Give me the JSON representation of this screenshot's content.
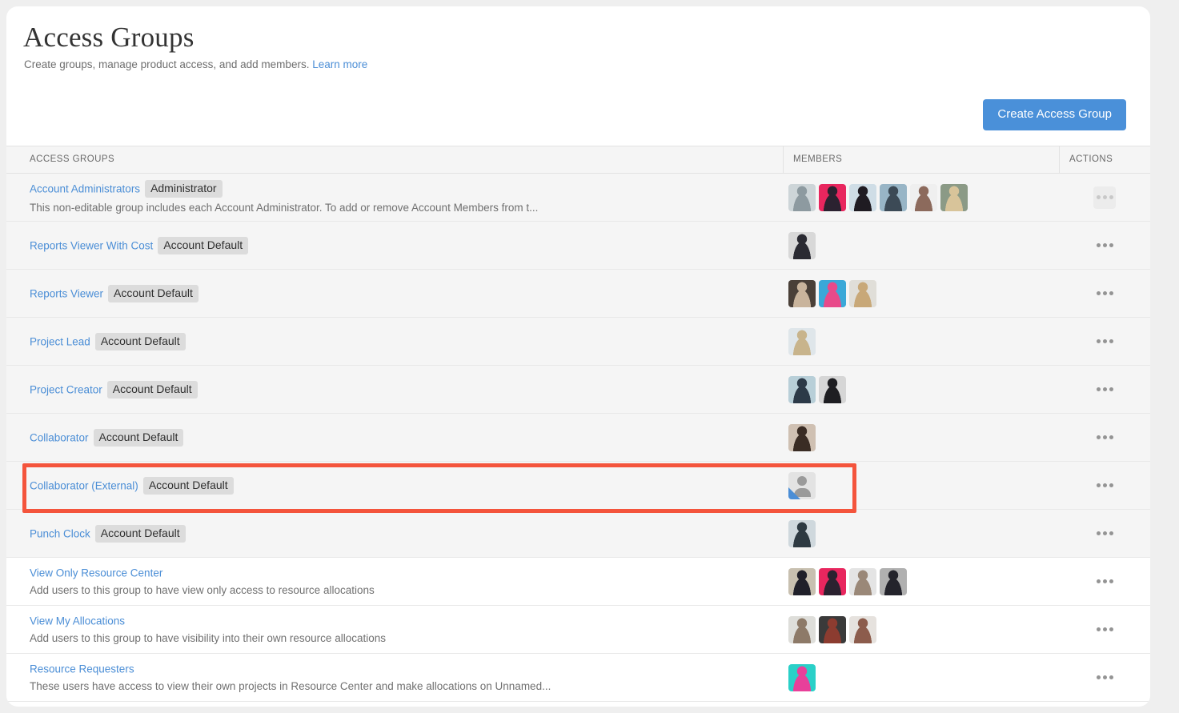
{
  "header": {
    "title": "Access Groups",
    "subtitle": "Create groups, manage product access, and add members.",
    "learn_more": "Learn more",
    "create_button": "Create Access Group"
  },
  "table": {
    "columns": [
      "ACCESS GROUPS",
      "MEMBERS",
      "ACTIONS"
    ],
    "rows": [
      {
        "name": "Account Administrators",
        "badge": "Administrator",
        "description": "This non-editable group includes each Account Administrator. To add or remove Account Members from t...",
        "shaded": true,
        "actions_muted": true,
        "members": [
          {
            "type": "photo",
            "colors": [
              "#cdd5d8",
              "#8d9aa0"
            ]
          },
          {
            "type": "photo",
            "colors": [
              "#e8265e",
              "#2b2230"
            ]
          },
          {
            "type": "photo",
            "colors": [
              "#cfdde6",
              "#1f1b22"
            ]
          },
          {
            "type": "photo",
            "colors": [
              "#98b5c6",
              "#3c4a56"
            ]
          },
          {
            "type": "photo",
            "colors": [
              "#efefef",
              "#8c6a5c"
            ]
          },
          {
            "type": "photo",
            "colors": [
              "#8b9a86",
              "#d8c49a"
            ]
          }
        ]
      },
      {
        "name": "Reports Viewer With Cost",
        "badge": "Account Default",
        "description": "",
        "shaded": true,
        "actions_muted": false,
        "members": [
          {
            "type": "photo",
            "colors": [
              "#d8d8d8",
              "#2a2a32"
            ]
          }
        ]
      },
      {
        "name": "Reports Viewer",
        "badge": "Account Default",
        "description": "",
        "shaded": true,
        "actions_muted": false,
        "members": [
          {
            "type": "photo",
            "colors": [
              "#4a4038",
              "#c9b49c"
            ]
          },
          {
            "type": "photo",
            "colors": [
              "#3aa8d8",
              "#e84a8a"
            ]
          },
          {
            "type": "photo",
            "colors": [
              "#e0ded8",
              "#c8a878"
            ]
          }
        ]
      },
      {
        "name": "Project Lead",
        "badge": "Account Default",
        "description": "",
        "shaded": true,
        "actions_muted": false,
        "members": [
          {
            "type": "photo",
            "colors": [
              "#dfe6ea",
              "#c8b48c"
            ]
          }
        ]
      },
      {
        "name": "Project Creator",
        "badge": "Account Default",
        "description": "",
        "shaded": true,
        "actions_muted": false,
        "members": [
          {
            "type": "photo",
            "colors": [
              "#b8cfd8",
              "#2c3a48"
            ]
          },
          {
            "type": "photo",
            "colors": [
              "#d6d6d6",
              "#1e1e22"
            ]
          }
        ]
      },
      {
        "name": "Collaborator",
        "badge": "Account Default",
        "description": "",
        "shaded": true,
        "actions_muted": false,
        "members": [
          {
            "type": "photo",
            "colors": [
              "#cfc0b2",
              "#3a2c24"
            ]
          }
        ]
      },
      {
        "name": "Collaborator (External)",
        "badge": "Account Default",
        "description": "",
        "shaded": true,
        "actions_muted": false,
        "highlighted": true,
        "members": [
          {
            "type": "placeholder"
          }
        ]
      },
      {
        "name": "Punch Clock",
        "badge": "Account Default",
        "description": "",
        "shaded": true,
        "actions_muted": false,
        "members": [
          {
            "type": "photo",
            "colors": [
              "#cfd8dd",
              "#2e3a42"
            ]
          }
        ]
      },
      {
        "name": "View Only Resource Center",
        "badge": "",
        "description": "Add users to this group to have view only access to resource allocations",
        "shaded": false,
        "actions_muted": false,
        "members": [
          {
            "type": "photo",
            "colors": [
              "#c8c0b0",
              "#20202a"
            ]
          },
          {
            "type": "photo",
            "colors": [
              "#e8265e",
              "#2b2230"
            ]
          },
          {
            "type": "photo",
            "colors": [
              "#e4e4e4",
              "#9a8878"
            ]
          },
          {
            "type": "photo",
            "colors": [
              "#b0b0b0",
              "#24242c"
            ]
          }
        ]
      },
      {
        "name": "View My Allocations",
        "badge": "",
        "description": "Add users to this group to have visibility into their own resource allocations",
        "shaded": false,
        "actions_muted": false,
        "members": [
          {
            "type": "photo",
            "colors": [
              "#dededa",
              "#8d7a68"
            ]
          },
          {
            "type": "photo",
            "colors": [
              "#3a3a3a",
              "#8c3c30"
            ]
          },
          {
            "type": "photo",
            "colors": [
              "#e6e2de",
              "#8c5c4c"
            ]
          }
        ]
      },
      {
        "name": "Resource Requesters",
        "badge": "",
        "description": "These users have access to view their own projects in Resource Center and make allocations on Unnamed...",
        "shaded": false,
        "actions_muted": false,
        "members": [
          {
            "type": "photo",
            "colors": [
              "#2ad0c8",
              "#e8409a"
            ]
          }
        ]
      }
    ]
  },
  "colors": {
    "accent": "#4a90d9",
    "link": "#4b8ed6",
    "highlight": "#f4543c",
    "badge_bg": "#dcdcdc",
    "row_shaded": "#f5f5f5"
  },
  "icons": {
    "actions_menu": "ellipsis-horizontal-icon",
    "placeholder_avatar": "person-placeholder-icon"
  }
}
